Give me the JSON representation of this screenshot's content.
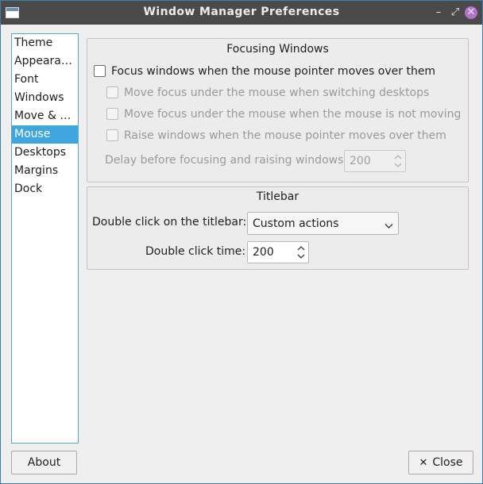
{
  "window": {
    "title": "Window Manager Preferences",
    "controls": {
      "minimize": "–",
      "maximize": "⤢",
      "close": "✕"
    }
  },
  "sidebar": {
    "items": [
      {
        "label": "Theme",
        "selected": false
      },
      {
        "label": "Appeara…",
        "selected": false
      },
      {
        "label": "Font",
        "selected": false
      },
      {
        "label": "Windows",
        "selected": false
      },
      {
        "label": "Move & …",
        "selected": false
      },
      {
        "label": "Mouse",
        "selected": true
      },
      {
        "label": "Desktops",
        "selected": false
      },
      {
        "label": "Margins",
        "selected": false
      },
      {
        "label": "Dock",
        "selected": false
      }
    ]
  },
  "focusing": {
    "title": "Focusing Windows",
    "focus_follows_mouse": {
      "label": "Focus windows when the mouse pointer moves over them",
      "checked": false,
      "enabled": true
    },
    "switching_desktops": {
      "label": "Move focus under the mouse when switching desktops",
      "checked": false,
      "enabled": false
    },
    "mouse_not_moving": {
      "label": "Move focus under the mouse when the mouse is not moving",
      "checked": false,
      "enabled": false
    },
    "raise_windows": {
      "label": "Raise windows when the mouse pointer moves over them",
      "checked": false,
      "enabled": false
    },
    "delay": {
      "label": "Delay before focusing and raising windows:",
      "value": "200",
      "enabled": false
    }
  },
  "titlebar": {
    "title": "Titlebar",
    "double_click_action": {
      "label": "Double click on the titlebar:",
      "value": "Custom actions"
    },
    "double_click_time": {
      "label": "Double click time:",
      "value": "200"
    }
  },
  "buttons": {
    "about": "About",
    "close": "Close",
    "close_icon": "✕"
  },
  "colors": {
    "selection": "#3ea6dc",
    "titlebar": "#4a4a4a",
    "close_button": "#b073c7",
    "border_accent": "#58a9c6"
  }
}
